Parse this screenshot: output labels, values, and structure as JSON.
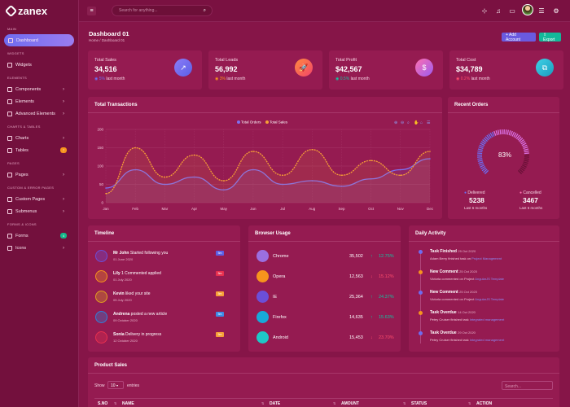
{
  "brand": "zanex",
  "sidebar": {
    "sections": [
      {
        "title": "MAIN",
        "items": [
          {
            "label": "Dashboard",
            "active": true
          }
        ]
      },
      {
        "title": "WIDGETS",
        "items": [
          {
            "label": "Widgets"
          }
        ]
      },
      {
        "title": "ELEMENTS",
        "items": [
          {
            "label": "Components",
            "chev": true
          },
          {
            "label": "Elements",
            "chev": true
          },
          {
            "label": "Advanced Elements",
            "chev": true
          }
        ]
      },
      {
        "title": "CHARTS & TABLES",
        "items": [
          {
            "label": "Charts",
            "chev": true
          },
          {
            "label": "Tables",
            "badge": "7",
            "badge_color": "#f7941d"
          }
        ]
      },
      {
        "title": "PAGES",
        "items": [
          {
            "label": "Pages",
            "chev": true
          }
        ]
      },
      {
        "title": "CUSTOM & ERROR PAGES",
        "items": [
          {
            "label": "Custom Pages",
            "chev": true
          },
          {
            "label": "Submenus",
            "chev": true
          }
        ]
      },
      {
        "title": "FORMS & ICONS",
        "items": [
          {
            "label": "Forms",
            "badge": "4",
            "badge_color": "#14b88a"
          },
          {
            "label": "Icons",
            "chev": true
          }
        ]
      }
    ]
  },
  "header": {
    "search_placeholder": "Search for anything..."
  },
  "page": {
    "title": "Dashboard 01",
    "crumb_home": "Home",
    "crumb_sep": "/",
    "crumb_current": "Dashboard 01",
    "add_account": "+ Add Account",
    "export": "⇪ Export"
  },
  "stats": [
    {
      "label": "Total Sales",
      "value": "34,516",
      "delta": "5%",
      "delta_color": "#6e6cf0",
      "note": "last month",
      "circle": "linear-gradient(135deg,#8b7cf7,#5b5fe6)",
      "icon": "↗"
    },
    {
      "label": "Total Leads",
      "value": "56,992",
      "delta": "3%",
      "delta_color": "#f7941d",
      "note": "last month",
      "circle": "linear-gradient(135deg,#ff8a3d,#f2456b)",
      "icon": "🚀"
    },
    {
      "label": "Total Profit",
      "value": "$42,567",
      "delta": "0.5%",
      "delta_color": "#13c2a0",
      "note": "last month",
      "circle": "linear-gradient(135deg,#ff6fb0,#9b5cf0)",
      "icon": "$"
    },
    {
      "label": "Total Cost",
      "value": "$34,789",
      "delta": "0.2%",
      "delta_color": "#ff4d6d",
      "note": "last month",
      "circle": "linear-gradient(135deg,#3fd2e6,#1b9bbf)",
      "icon": "⧉"
    }
  ],
  "transactions": {
    "title": "Total Transactions"
  },
  "chart_data": {
    "type": "line",
    "title": "",
    "categories": [
      "Jan",
      "Feb",
      "Mar",
      "Apr",
      "May",
      "Jun",
      "Jul",
      "Aug",
      "Sep",
      "Oct",
      "Nov",
      "Dec"
    ],
    "ylim": [
      0,
      200
    ],
    "yticks": [
      "0",
      "50",
      "100",
      "150",
      "200"
    ],
    "series": [
      {
        "name": "Total Orders",
        "color": "#7f70f0",
        "values": [
          40,
          90,
          50,
          70,
          35,
          90,
          50,
          60,
          45,
          65,
          90,
          120
        ]
      },
      {
        "name": "Total Sales",
        "color": "#f7a036",
        "values": [
          25,
          150,
          70,
          130,
          60,
          140,
          75,
          145,
          75,
          115,
          75,
          140
        ]
      }
    ]
  },
  "recent": {
    "title": "Recent Orders",
    "percent": "83%",
    "percent_value": 83,
    "delivered_label": "Delivered",
    "delivered_value": "5238",
    "delivered_note": "Last 6 months",
    "cancelled_label": "Cancelled",
    "cancelled_value": "3467",
    "cancelled_note": "Last 6 months"
  },
  "timeline": {
    "title": "Timeline",
    "items": [
      {
        "name": "Mr John",
        "text": "Started following you",
        "date": "01 June 2020",
        "tag": "5m",
        "tag_color": "#5b5fe6",
        "icon_color": "#6b4fd8"
      },
      {
        "name": "Lily",
        "text": "1 Commented applied",
        "date": "01 July 2020",
        "tag": "5m",
        "tag_color": "#e8304f",
        "icon_color": "#f7941d"
      },
      {
        "name": "Kevin",
        "text": "liked your site",
        "date": "05 July 2020",
        "tag": "5m",
        "tag_color": "#f7a036",
        "icon_color": "#e2a020"
      },
      {
        "name": "Andrena",
        "text": "posted a new article",
        "date": "09 October 2020",
        "tag": "5m",
        "tag_color": "#3b8ce8",
        "icon_color": "#2f80d8"
      },
      {
        "name": "Sonia",
        "text": "Delivery in progress",
        "date": "12 October 2020",
        "tag": "5m",
        "tag_color": "#f7a036",
        "icon_color": "#e8304f"
      }
    ]
  },
  "browser": {
    "title": "Browser Usage",
    "items": [
      {
        "name": "Chrome",
        "value": "35,502",
        "pct": "12.75%",
        "up": true,
        "color": "#9b6fe0"
      },
      {
        "name": "Opera",
        "value": "12,563",
        "pct": "15.12%",
        "up": false,
        "color": "#f7941d"
      },
      {
        "name": "IE",
        "value": "25,364",
        "pct": "24.37%",
        "up": true,
        "color": "#6b4fd8"
      },
      {
        "name": "Firefox",
        "value": "14,635",
        "pct": "15.63%",
        "up": true,
        "color": "#18a9d8"
      },
      {
        "name": "Android",
        "value": "15,453",
        "pct": "23.70%",
        "up": false,
        "color": "#1fc7c7"
      }
    ]
  },
  "activity": {
    "title": "Daily Activity",
    "items": [
      {
        "title": "Task Finished",
        "date": "29 Oct 2020",
        "text": "Adam Berry finished task on",
        "link": "Project Management",
        "dot": "#6e6cf0"
      },
      {
        "title": "New Comment",
        "date": "25 Oct 2020",
        "text": "Victoria commented on Project",
        "link": "AngularJS Template",
        "dot": "#f7941d"
      },
      {
        "title": "New Comment",
        "date": "25 Oct 2020",
        "text": "Victoria commented on Project",
        "link": "AngularJS Template",
        "dot": "#6e6cf0"
      },
      {
        "title": "Task Overdue",
        "date": "14 Oct 2020",
        "text": "Petey Cruiser finished task",
        "link": "Integrated management",
        "dot": "#f7941d"
      },
      {
        "title": "Task Overdue",
        "date": "29 Oct 2020",
        "text": "Petey Cruiser finished task",
        "link": "Integrated management",
        "dot": "#6e6cf0"
      }
    ]
  },
  "product": {
    "title": "Product Sales",
    "show": "Show",
    "entries_value": "10",
    "entries": "entries",
    "search_placeholder": "Search...",
    "columns": [
      "S.NO",
      "NAME",
      "DATE",
      "AMOUNT",
      "STATUS",
      "ACTION"
    ]
  }
}
